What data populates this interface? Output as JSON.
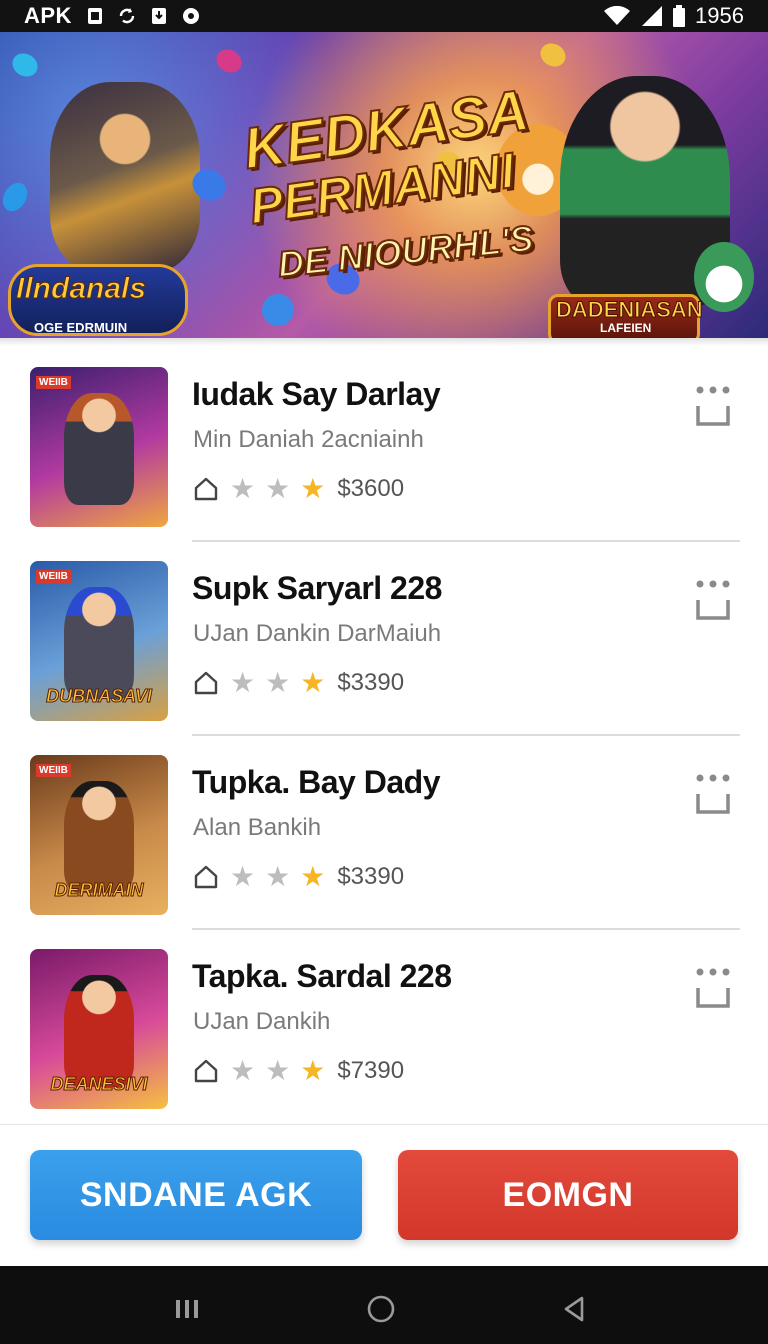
{
  "status_bar": {
    "carrier": "APK",
    "time": "1956"
  },
  "banner": {
    "title_line1": "KEDKASA",
    "title_line2": "PERMANNI",
    "title_line3": "DE NIOURHL'S",
    "logo_title": "Ilndanals",
    "logo_subtitle": "OGE EDRMUIN",
    "badge_title": "DADENIASAN",
    "badge_subtitle": "LAFEIEN"
  },
  "games": [
    {
      "title": "Iudak Say Darlay",
      "subtitle": "Min Daniah  2acniainh",
      "price": "$3600",
      "tag": "WEIIB",
      "thumb_label": "",
      "rating_stars": [
        false,
        false,
        true
      ],
      "thumb_colors": [
        "#3b1f6e",
        "#b23aa0",
        "#f0a640"
      ]
    },
    {
      "title": "Supk Saryarl 228",
      "subtitle": "UJan Dankin  DarMaiuh",
      "price": "$3390",
      "tag": "WEIIB",
      "thumb_label": "DUBNASAVI",
      "rating_stars": [
        false,
        false,
        true
      ],
      "thumb_colors": [
        "#2a5aa8",
        "#6aa0d8",
        "#d9a040"
      ]
    },
    {
      "title": "Tupka. Bay Dady",
      "subtitle": "Alan Bankih",
      "price": "$3390",
      "tag": "WEIIB",
      "thumb_label": "DERIMAIN",
      "rating_stars": [
        false,
        false,
        true
      ],
      "thumb_colors": [
        "#6a3a1a",
        "#c88a4a",
        "#e8b060"
      ]
    },
    {
      "title": "Tapka. Sardal  228",
      "subtitle": "UJan Dankih",
      "price": "$7390",
      "tag": "",
      "thumb_label": "DEANESIVI",
      "rating_stars": [
        false,
        false,
        true
      ],
      "thumb_colors": [
        "#7a1a6a",
        "#d84a9a",
        "#f5c040"
      ]
    }
  ],
  "actions": {
    "primary_label": "SNDANE AGK",
    "secondary_label": "EOMGN",
    "primary_color": "#2a8be0",
    "secondary_color": "#d2372a"
  },
  "icons": {
    "status": [
      "sim-icon",
      "sync-icon",
      "download-icon",
      "record-icon",
      "wifi-icon",
      "signal-icon",
      "battery-icon"
    ],
    "nav": [
      "recents-icon",
      "home-nav-icon",
      "back-icon"
    ]
  }
}
